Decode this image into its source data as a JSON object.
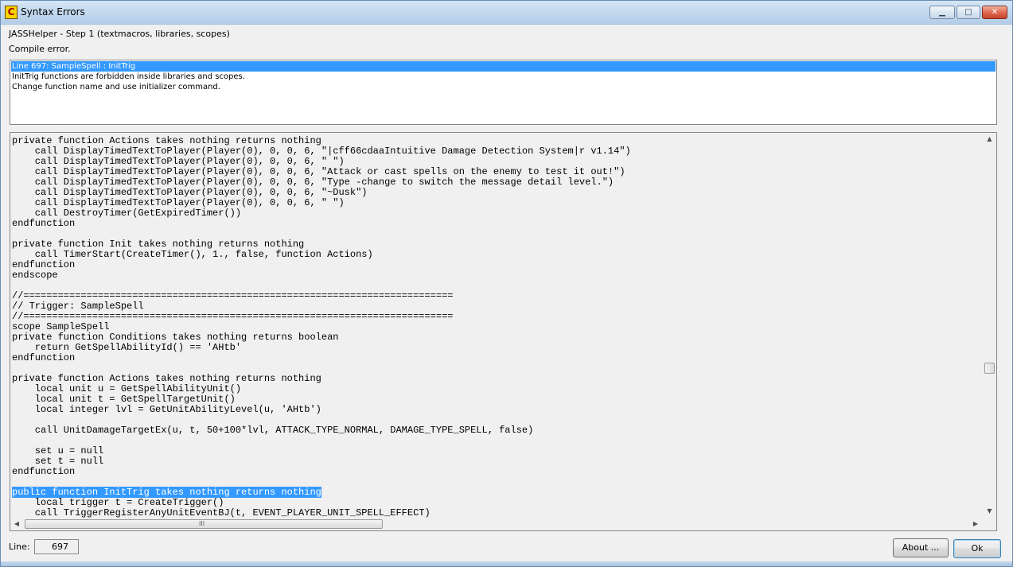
{
  "window": {
    "title": "Syntax Errors",
    "icon_letter": "C",
    "minimize_glyph": "▁",
    "maximize_glyph": "□",
    "close_glyph": "✕"
  },
  "header": {
    "step": "JASSHelper - Step 1 (textmacros, libraries, scopes)",
    "status": "Compile error."
  },
  "errors": [
    "Line 697: SampleSpell : InitTrig",
    "InitTrig functions are forbidden inside libraries and scopes.",
    "Change function name and use initializer command."
  ],
  "code": {
    "lines": [
      "private function Actions takes nothing returns nothing",
      "    call DisplayTimedTextToPlayer(Player(0), 0, 0, 6, \"|cff66cdaaIntuitive Damage Detection System|r v1.14\")",
      "    call DisplayTimedTextToPlayer(Player(0), 0, 0, 6, \" \")",
      "    call DisplayTimedTextToPlayer(Player(0), 0, 0, 6, \"Attack or cast spells on the enemy to test it out!\")",
      "    call DisplayTimedTextToPlayer(Player(0), 0, 0, 6, \"Type -change to switch the message detail level.\")",
      "    call DisplayTimedTextToPlayer(Player(0), 0, 0, 6, \"~Dusk\")",
      "    call DisplayTimedTextToPlayer(Player(0), 0, 0, 6, \" \")",
      "    call DestroyTimer(GetExpiredTimer())",
      "endfunction",
      "",
      "private function Init takes nothing returns nothing",
      "    call TimerStart(CreateTimer(), 1., false, function Actions)",
      "endfunction",
      "endscope",
      "",
      "//===========================================================================",
      "// Trigger: SampleSpell",
      "//===========================================================================",
      "scope SampleSpell",
      "private function Conditions takes nothing returns boolean",
      "    return GetSpellAbilityId() == 'AHtb'",
      "endfunction",
      "",
      "private function Actions takes nothing returns nothing",
      "    local unit u = GetSpellAbilityUnit()",
      "    local unit t = GetSpellTargetUnit()",
      "    local integer lvl = GetUnitAbilityLevel(u, 'AHtb')",
      "",
      "    call UnitDamageTargetEx(u, t, 50+100*lvl, ATTACK_TYPE_NORMAL, DAMAGE_TYPE_SPELL, false)",
      "",
      "    set u = null",
      "    set t = null",
      "endfunction",
      "",
      "public function InitTrig takes nothing returns nothing",
      "    local trigger t = CreateTrigger()",
      "    call TriggerRegisterAnyUnitEventBJ(t, EVENT_PLAYER_UNIT_SPELL_EFFECT)"
    ],
    "highlighted_line_index": 34
  },
  "scrollbars": {
    "up_arrow": "▲",
    "down_arrow": "▼",
    "left_arrow": "◀",
    "right_arrow": "▶",
    "grip": "III"
  },
  "footer": {
    "line_label": "Line:",
    "line_value": "697",
    "about_label": "About ...",
    "ok_label": "Ok"
  },
  "colors": {
    "selection": "#3399ff",
    "titlebar": "#c2d8ee"
  }
}
